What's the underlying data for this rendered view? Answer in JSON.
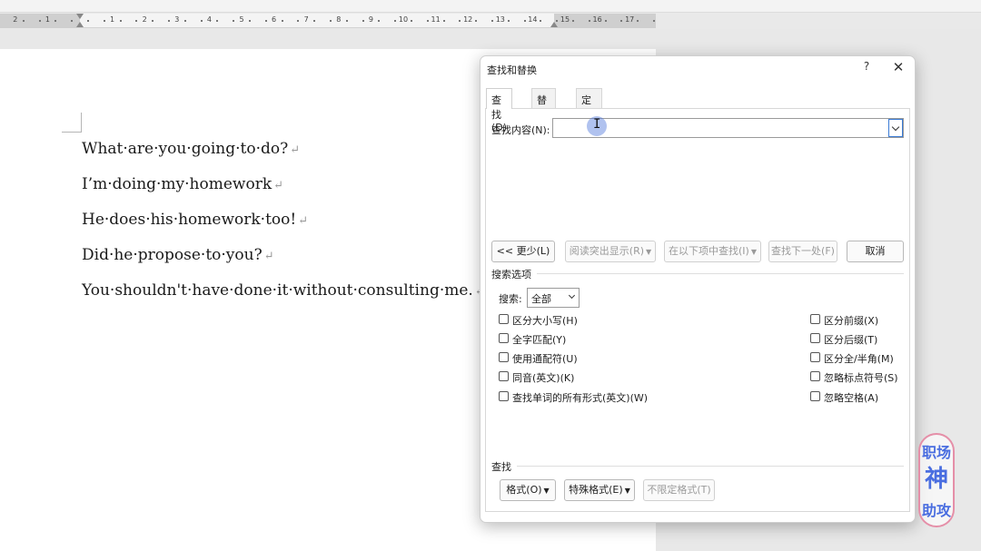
{
  "ruler": {
    "numbers": [
      "2",
      "1",
      "1",
      "2",
      "3",
      "4",
      "5",
      "6",
      "7",
      "8",
      "9",
      "10",
      "11",
      "12",
      "13",
      "14",
      "15",
      "16",
      "17"
    ]
  },
  "document": {
    "lines": [
      "What·are·you·going·to·do?",
      "I’m·doing·my·homework",
      "He·does·his·homework·too!",
      "Did·he·propose·to·you?",
      "You·shouldn't·have·done·it·without·consulting·me."
    ],
    "paragraph_mark": "↵"
  },
  "dialog": {
    "title": "查找和替换",
    "help": "?",
    "close": "✕",
    "tabs": [
      {
        "label": "查找(D)",
        "active": true
      },
      {
        "label": "替换(P)",
        "active": false
      },
      {
        "label": "定位(G)",
        "active": false
      }
    ],
    "find_label": "查找内容(N):",
    "find_value": "",
    "buttons": {
      "less": "<< 更少(L)",
      "reading_highlight": "阅读突出显示(R)",
      "find_in": "在以下项中查找(I)",
      "find_next": "查找下一处(F)",
      "cancel": "取消"
    },
    "search_options_label": "搜索选项",
    "search_label": "搜索:",
    "search_value": "全部",
    "checkboxes_left": [
      {
        "label": "区分大小写(H)",
        "checked": false
      },
      {
        "label": "全字匹配(Y)",
        "checked": false
      },
      {
        "label": "使用通配符(U)",
        "checked": false
      },
      {
        "label": "同音(英文)(K)",
        "checked": false
      },
      {
        "label": "查找单词的所有形式(英文)(W)",
        "checked": false
      }
    ],
    "checkboxes_right": [
      {
        "label": "区分前缀(X)",
        "checked": false
      },
      {
        "label": "区分后缀(T)",
        "checked": false
      },
      {
        "label": "区分全/半角(M)",
        "checked": false
      },
      {
        "label": "忽略标点符号(S)",
        "checked": false
      },
      {
        "label": "忽略空格(A)",
        "checked": false
      }
    ],
    "find_section_label": "查找",
    "bottom_buttons": {
      "format": "格式(O)",
      "special": "特殊格式(E)",
      "no_format": "不限定格式(T)"
    }
  },
  "watermark": {
    "line1": "职场",
    "line2": "神",
    "line3": "助攻"
  }
}
